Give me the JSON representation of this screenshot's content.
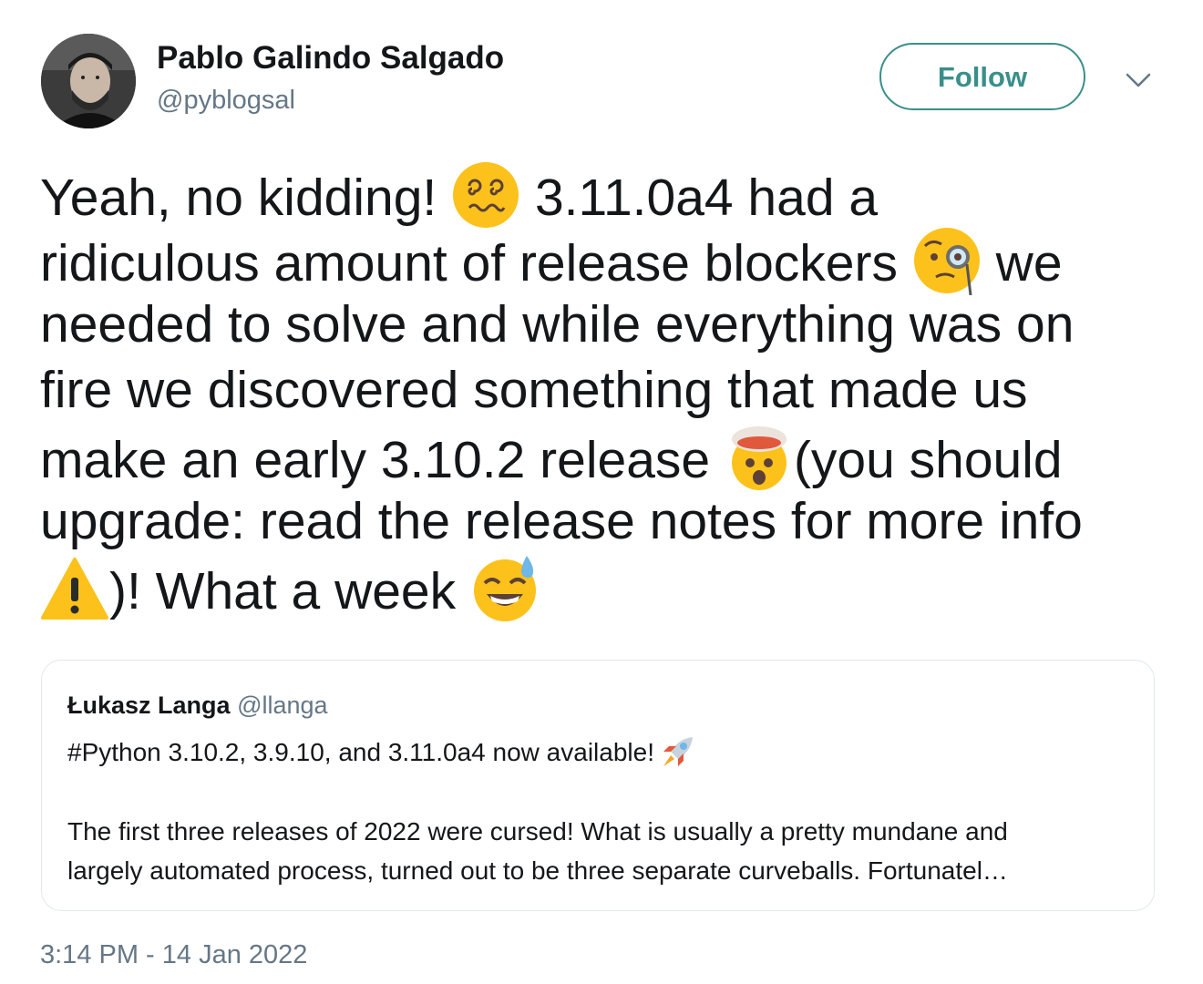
{
  "author": {
    "name": "Pablo Galindo Salgado",
    "handle": "@pyblogsal"
  },
  "follow_label": "Follow",
  "tweet_lines": [
    {
      "parts": [
        "Yeah, no kidding! ",
        "",
        " 3.11.0a4 had a"
      ]
    },
    {
      "parts": [
        "ridiculous amount of release blockers ",
        "",
        " we"
      ]
    },
    {
      "parts": [
        "needed to solve and while everything was on"
      ]
    },
    {
      "parts": [
        "fire we discovered something that made us"
      ]
    },
    {
      "parts": [
        "make an early 3.10.2 release ",
        "",
        "(you should"
      ]
    },
    {
      "parts": [
        "upgrade: read the release notes for more info"
      ]
    },
    {
      "parts": [
        "",
        ")! What a week ",
        ""
      ]
    }
  ],
  "emojis": {
    "dizzy": "dizzy-face-icon",
    "monocle": "face-with-monocle-icon",
    "exploding": "exploding-head-icon",
    "warning": "warning-icon",
    "sweat": "grinning-sweat-icon",
    "rocket": "rocket-icon"
  },
  "quote": {
    "name": "Łukasz Langa",
    "handle": "@llanga",
    "line1": "#Python 3.10.2, 3.9.10, and 3.11.0a4 now available!",
    "para_lines": [
      "The first three releases of 2022 were cursed! What is usually a pretty mundane and",
      "largely automated process, turned out to be three separate curveballs. Fortunatel…"
    ]
  },
  "timestamp": "3:14 PM - 14 Jan 2022",
  "colors": {
    "accent": "#3a8f8a",
    "secondary_text": "#657786",
    "border": "#e1e8ed",
    "emoji_yellow": "#fcc21b"
  }
}
